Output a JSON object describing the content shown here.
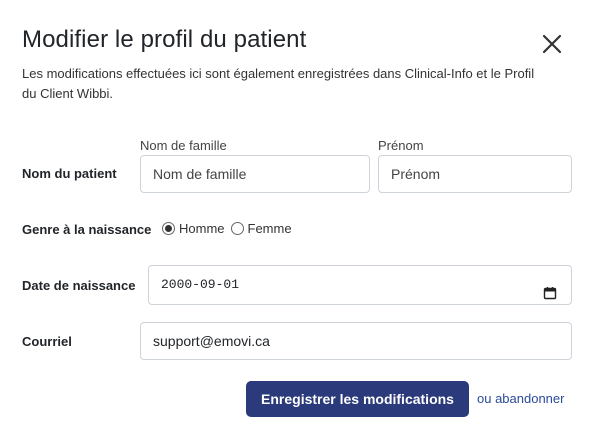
{
  "dialog": {
    "title": "Modifier le profil du patient",
    "description": "Les modifications effectuées ici sont également enregistrées dans Clinical-Info et le Profil du Client Wibbi.",
    "close_icon": "close-icon"
  },
  "patient_name": {
    "label": "Nom du patient",
    "last_name_caption": "Nom de famille",
    "last_name_value": "Nom de famille",
    "first_name_caption": "Prénom",
    "first_name_value": "Prénom"
  },
  "gender": {
    "label": "Genre à la naissance",
    "options": [
      {
        "label": "Homme",
        "checked": true
      },
      {
        "label": "Femme",
        "checked": false
      }
    ]
  },
  "birth_date": {
    "label": "Date de naissance",
    "value": "2000-09-01",
    "icon": "calendar-icon"
  },
  "email": {
    "label": "Courriel",
    "value": "support@emovi.ca"
  },
  "actions": {
    "submit_label": "Enregistrer les modifications",
    "cancel_label": "ou abandonner"
  },
  "colors": {
    "primary_button": "#2b3a7a",
    "link": "#2b4a9a",
    "border": "#ced4da"
  }
}
